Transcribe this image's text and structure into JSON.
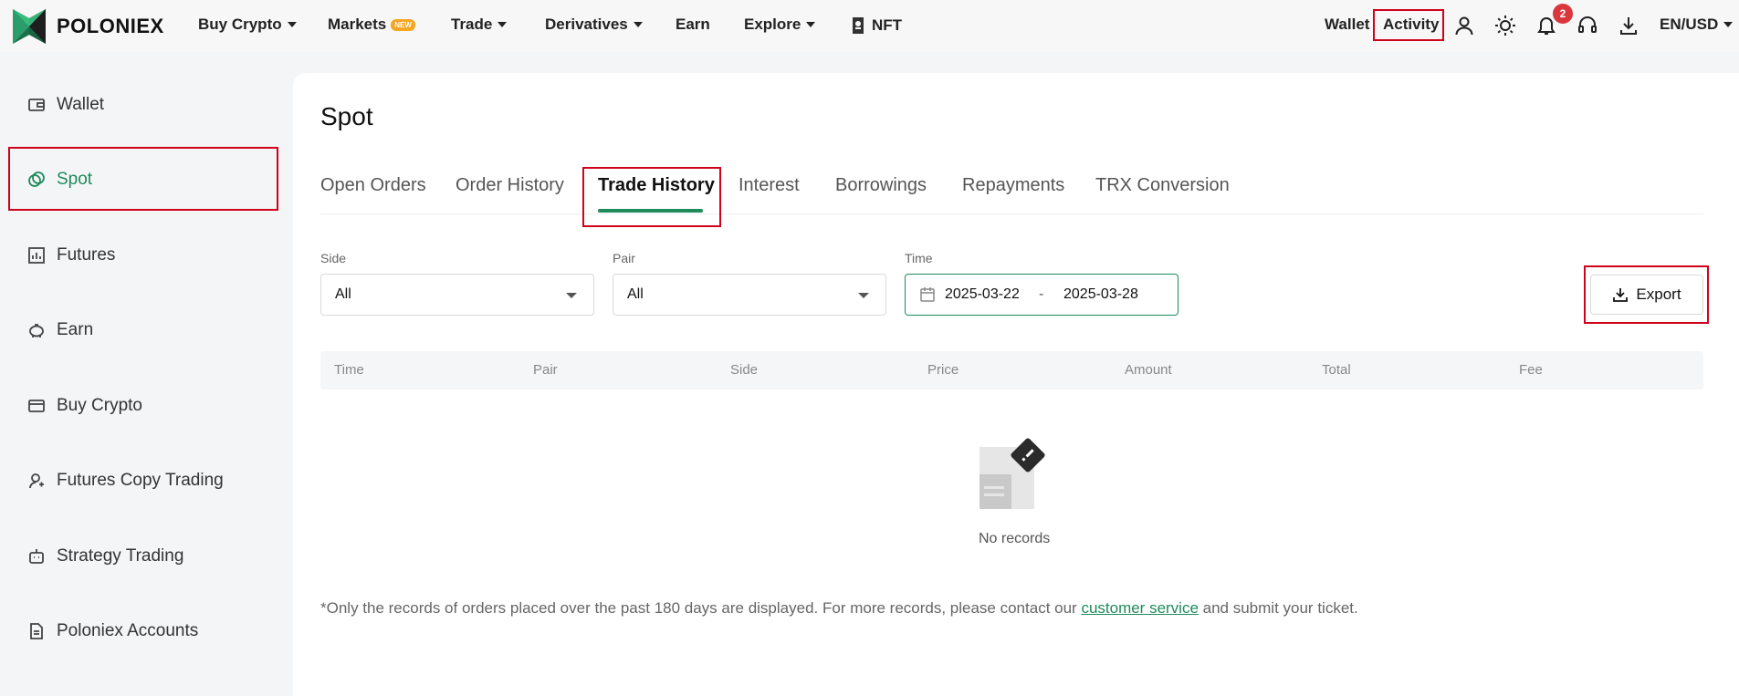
{
  "header": {
    "brand": "POLONIEX",
    "nav": [
      {
        "label": "Buy Crypto",
        "has_caret": true
      },
      {
        "label": "Markets",
        "badge": "NEW"
      },
      {
        "label": "Trade",
        "has_caret": true
      },
      {
        "label": "Derivatives",
        "has_caret": true
      },
      {
        "label": "Earn"
      },
      {
        "label": "Explore",
        "has_caret": true
      },
      {
        "label": "NFT"
      }
    ],
    "wallet_label": "Wallet",
    "activity_label": "Activity",
    "notification_count": "2",
    "locale_label": "EN/USD",
    "icons": [
      "user-icon",
      "theme-sun-icon",
      "bell-icon",
      "headset-icon",
      "download-icon"
    ]
  },
  "sidebar": {
    "items": [
      {
        "label": "Wallet",
        "icon": "wallet-icon",
        "active": false
      },
      {
        "label": "Spot",
        "icon": "spot-icon",
        "active": true
      },
      {
        "label": "Futures",
        "icon": "futures-chart-icon",
        "active": false
      },
      {
        "label": "Earn",
        "icon": "piggy-bank-icon",
        "active": false
      },
      {
        "label": "Buy Crypto",
        "icon": "card-icon",
        "active": false
      },
      {
        "label": "Futures Copy Trading",
        "icon": "copy-user-icon",
        "active": false
      },
      {
        "label": "Strategy Trading",
        "icon": "robot-icon",
        "active": false
      },
      {
        "label": "Poloniex Accounts",
        "icon": "document-icon",
        "active": false
      }
    ]
  },
  "main": {
    "title": "Spot",
    "tabs": [
      {
        "label": "Open Orders",
        "active": false
      },
      {
        "label": "Order History",
        "active": false
      },
      {
        "label": "Trade History",
        "active": true
      },
      {
        "label": "Interest",
        "active": false
      },
      {
        "label": "Borrowings",
        "active": false
      },
      {
        "label": "Repayments",
        "active": false
      },
      {
        "label": "TRX Conversion",
        "active": false
      }
    ],
    "filters": {
      "side": {
        "label": "Side",
        "value": "All"
      },
      "pair": {
        "label": "Pair",
        "value": "All"
      },
      "time": {
        "label": "Time",
        "start": "2025-03-22",
        "separator": "-",
        "end": "2025-03-28"
      }
    },
    "export_label": "Export",
    "table": {
      "columns": [
        "Time",
        "Pair",
        "Side",
        "Price",
        "Amount",
        "Total",
        "Fee"
      ],
      "rows": []
    },
    "empty_text": "No records",
    "footnote": {
      "prefix": "*Only the records of orders placed over the past 180 days are displayed. For more records, please contact our ",
      "link": "customer service",
      "suffix": " and submit your ticket."
    }
  },
  "colors": {
    "accent": "#1f8a5b",
    "highlight": "#d0021b",
    "badge_red": "#d9363e",
    "new_badge": "#f5a623"
  }
}
